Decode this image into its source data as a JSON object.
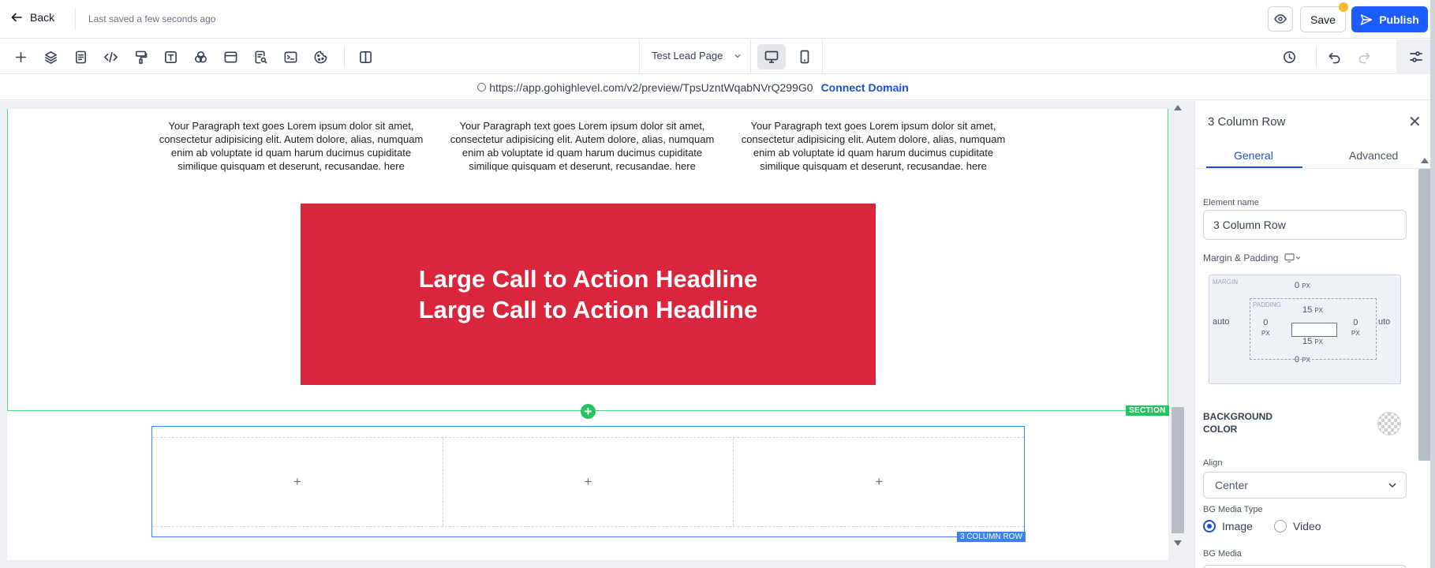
{
  "topbar": {
    "back_label": "Back",
    "saved_status": "Last saved a few seconds ago",
    "save_label": "Save",
    "publish_label": "Publish"
  },
  "toolbar": {
    "tools": [
      "add-icon",
      "layers-icon",
      "pages-icon",
      "code-icon",
      "paint-roller-icon",
      "text-icon",
      "color-circles-icon",
      "window-icon",
      "page-search-icon",
      "terminal-icon",
      "cookie-icon",
      "columns-icon"
    ],
    "page_selector": "Test Lead Page"
  },
  "urlbar": {
    "url": "https://app.gohighlevel.com/v2/preview/TpsUzntWqabNVrQ299G0",
    "connect_label": "Connect Domain"
  },
  "canvas": {
    "paragraphs": [
      "Your Paragraph text goes Lorem ipsum dolor sit amet, consectetur adipisicing elit. Autem dolore, alias, numquam enim ab voluptate id quam harum ducimus cupiditate similique quisquam et deserunt, recusandae. here",
      "Your Paragraph text goes Lorem ipsum dolor sit amet, consectetur adipisicing elit. Autem dolore, alias, numquam enim ab voluptate id quam harum ducimus cupiditate similique quisquam et deserunt, recusandae. here",
      "Your Paragraph text goes Lorem ipsum dolor sit amet, consectetur adipisicing elit. Autem dolore, alias, numquam enim ab voluptate id quam harum ducimus cupiditate similique quisquam et deserunt, recusandae. here"
    ],
    "cta_line_1": "Large Call to Action Headline",
    "cta_line_2": "Large Call to Action Headline",
    "section_tag": "SECTION",
    "row_tag": "3 COLUMN ROW",
    "column_placeholder": "+",
    "add_symbol": "+"
  },
  "panel": {
    "title": "3 Column Row",
    "tabs": [
      "General",
      "Advanced"
    ],
    "element_name_label": "Element name",
    "element_name_value": "3 Column Row",
    "margin_padding_label": "Margin & Padding",
    "margin_label": "MARGIN",
    "padding_label": "PADDING",
    "margin_top": "0",
    "margin_bottom": "0",
    "margin_left": "auto",
    "margin_right": "uto",
    "padding_top": "15",
    "padding_bottom": "15",
    "padding_left": "0",
    "padding_right": "0",
    "unit": "PX",
    "background_color_label": "BACKGROUND COLOR",
    "align_label": "Align",
    "align_value": "Center",
    "bg_media_type_label": "BG Media Type",
    "bg_media_options": [
      "Image",
      "Video"
    ],
    "bg_media_label": "BG Media"
  },
  "colors": {
    "accent": "#1d5cff",
    "cta_bg": "#d9263d",
    "section_green": "#22c55e",
    "row_blue": "#3b82f6"
  }
}
